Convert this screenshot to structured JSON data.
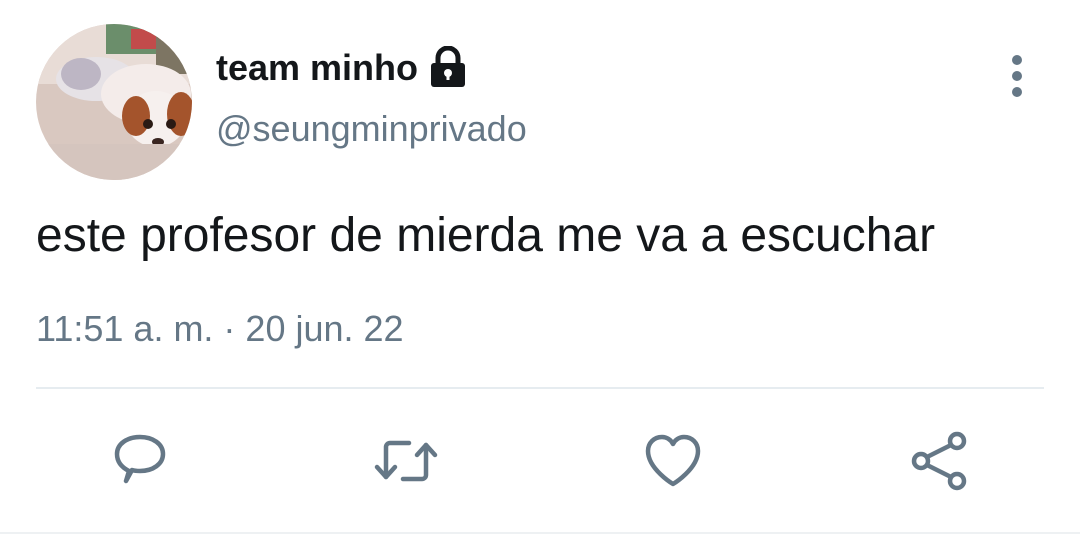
{
  "tweet": {
    "display_name": "team minho",
    "handle": "@seungminprivado",
    "text": "este profesor de mierda me va a escuchar",
    "timestamp": "11:51 a. m. · 20 jun. 22",
    "protected_icon": "lock-icon",
    "avatar": "dog-photo-avatar"
  },
  "actions": [
    {
      "icon": "reply-icon"
    },
    {
      "icon": "retweet-icon"
    },
    {
      "icon": "like-icon"
    },
    {
      "icon": "share-icon"
    }
  ],
  "colors": {
    "primary_text": "#14171a",
    "secondary_text": "#657786",
    "icon": "#657786",
    "divider": "#e6ecf0",
    "background": "#ffffff"
  }
}
